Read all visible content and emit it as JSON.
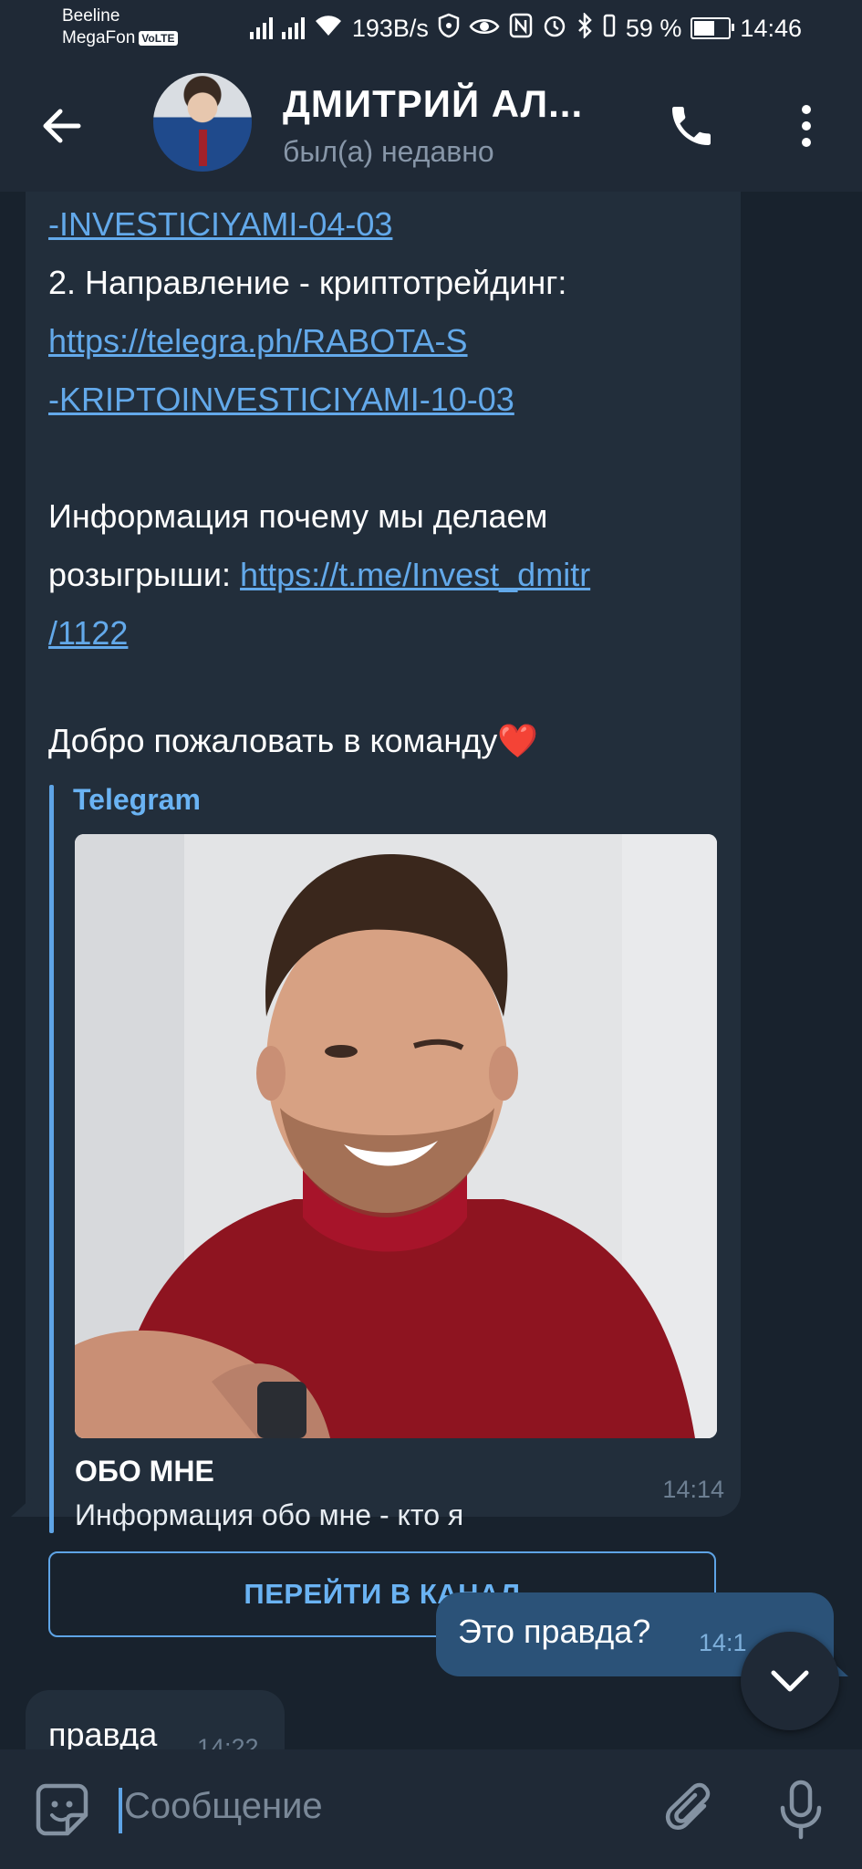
{
  "status_bar": {
    "carrier1": "Beeline",
    "carrier2": "MegaFon",
    "volte": "VoLTE",
    "speed": "193B/s",
    "battery": "59 %",
    "battery_level": 0.59,
    "time": "14:46"
  },
  "header": {
    "title": "ДМИТРИЙ АЛ...",
    "status": "был(а) недавно"
  },
  "message_in": {
    "lines": [
      "-INVESTICIYAMI-04-03",
      "2. Направление - криптотрейдинг:",
      "https://telegra.ph/RABOTA-S",
      "-KRIPTOINVESTICIYAMI-10-03",
      "Информация почему мы делаем",
      "розыгрыши: ",
      "https://t.me/Invest_dmitr",
      "/1122",
      "Добро пожаловать в команду"
    ],
    "heart": "❤️",
    "preview": {
      "site_name": "Telegram",
      "title": "ОБО МНЕ",
      "description": "Информация обо мне - кто я"
    },
    "button_label": "ПЕРЕЙТИ В КАНАЛ",
    "time": "14:14"
  },
  "message_out": {
    "text": "Это правда?",
    "time": "14:1"
  },
  "message_in2": {
    "text": "правда",
    "time": "14:22"
  },
  "input": {
    "placeholder": "Сообщение"
  }
}
